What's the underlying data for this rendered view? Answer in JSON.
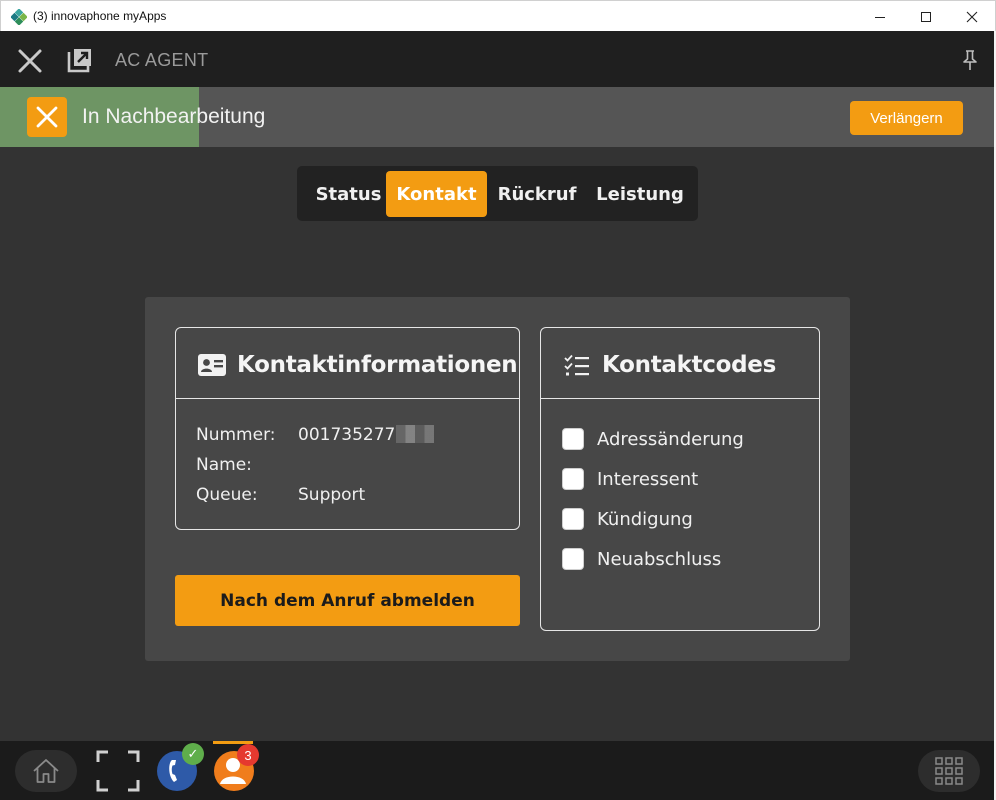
{
  "window": {
    "title": "(3) innovaphone myApps"
  },
  "header": {
    "title": "AC AGENT"
  },
  "status_bar": {
    "text": "In Nachbearbeitung",
    "progress": 0.2,
    "extend_label": "Verlängern",
    "progress_color": "#6e9564"
  },
  "tabs": [
    {
      "label": "Status",
      "active": false
    },
    {
      "label": "Kontakt",
      "active": true
    },
    {
      "label": "Rückruf",
      "active": false
    },
    {
      "label": "Leistung",
      "active": false
    }
  ],
  "contact_info": {
    "title": "Kontaktinformationen",
    "rows": [
      {
        "label": "Nummer:",
        "value": "001735277"
      },
      {
        "label": "Name:",
        "value": ""
      },
      {
        "label": "Queue:",
        "value": "Support"
      }
    ]
  },
  "logout_button": {
    "label": "Nach dem Anruf abmelden"
  },
  "contact_codes": {
    "title": "Kontaktcodes",
    "items": [
      {
        "label": "Adressänderung",
        "checked": false
      },
      {
        "label": "Interessent",
        "checked": false
      },
      {
        "label": "Kündigung",
        "checked": false
      },
      {
        "label": "Neuabschluss",
        "checked": false
      }
    ]
  },
  "taskbar": {
    "agent_badge": "3",
    "phone_badge": "✓"
  },
  "colors": {
    "accent": "#f39c12",
    "background": "#333333",
    "panel": "#474747",
    "header": "#1f1f1f"
  },
  "icons": {
    "close": "close-icon",
    "popout": "popout-icon",
    "pin": "pin-icon",
    "contact_card": "contact-card-icon",
    "checklist": "checklist-icon",
    "home": "home-icon",
    "fullscreen": "fullscreen-icon",
    "grid": "grid-icon"
  }
}
